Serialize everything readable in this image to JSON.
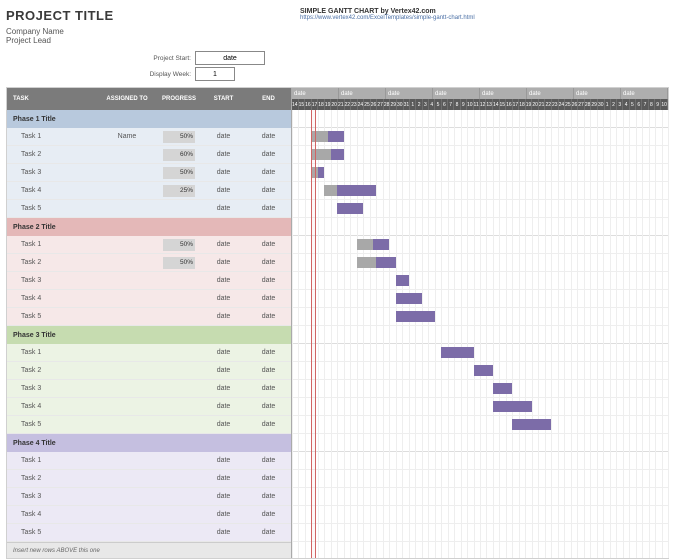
{
  "header": {
    "title": "PROJECT TITLE",
    "company": "Company Name",
    "lead": "Project Lead",
    "credit": "SIMPLE GANTT CHART by Vertex42.com",
    "url": "https://www.vertex42.com/ExcelTemplates/simple-gantt-chart.html",
    "project_start_label": "Project Start:",
    "project_start_value": "date",
    "display_week_label": "Display Week:",
    "display_week_value": "1"
  },
  "columns": {
    "task": "TASK",
    "assigned": "ASSIGNED TO",
    "progress": "PROGRESS",
    "start": "START",
    "end": "END"
  },
  "timeline": {
    "weeks": [
      "date",
      "date",
      "date",
      "date",
      "date",
      "date",
      "date",
      "date"
    ],
    "days": [
      "14",
      "15",
      "16",
      "17",
      "18",
      "19",
      "20",
      "21",
      "22",
      "23",
      "24",
      "25",
      "26",
      "27",
      "28",
      "29",
      "30",
      "31",
      "1",
      "2",
      "3",
      "4",
      "5",
      "6",
      "7",
      "8",
      "9",
      "10",
      "11",
      "12",
      "13",
      "14",
      "15",
      "16",
      "17",
      "18",
      "19",
      "20",
      "21",
      "22",
      "23",
      "24",
      "25",
      "26",
      "27",
      "28",
      "29",
      "30",
      "1",
      "2",
      "3",
      "4",
      "5",
      "6",
      "7",
      "8",
      "9",
      "10"
    ],
    "today_index": 3
  },
  "footer": "Insert new rows ABOVE this one",
  "phases": [
    {
      "title": "Phase 1 Title",
      "cls": "1",
      "tasks": [
        {
          "name": "Task 1",
          "assigned": "Name",
          "progress": "50%",
          "start": "date",
          "end": "date"
        },
        {
          "name": "Task 2",
          "assigned": "",
          "progress": "60%",
          "start": "date",
          "end": "date"
        },
        {
          "name": "Task 3",
          "assigned": "",
          "progress": "50%",
          "start": "date",
          "end": "date"
        },
        {
          "name": "Task 4",
          "assigned": "",
          "progress": "25%",
          "start": "date",
          "end": "date"
        },
        {
          "name": "Task 5",
          "assigned": "",
          "progress": "",
          "start": "date",
          "end": "date"
        }
      ]
    },
    {
      "title": "Phase 2 Title",
      "cls": "2",
      "tasks": [
        {
          "name": "Task 1",
          "assigned": "",
          "progress": "50%",
          "start": "date",
          "end": "date"
        },
        {
          "name": "Task 2",
          "assigned": "",
          "progress": "50%",
          "start": "date",
          "end": "date"
        },
        {
          "name": "Task 3",
          "assigned": "",
          "progress": "",
          "start": "date",
          "end": "date"
        },
        {
          "name": "Task 4",
          "assigned": "",
          "progress": "",
          "start": "date",
          "end": "date"
        },
        {
          "name": "Task 5",
          "assigned": "",
          "progress": "",
          "start": "date",
          "end": "date"
        }
      ]
    },
    {
      "title": "Phase 3 Title",
      "cls": "3",
      "tasks": [
        {
          "name": "Task 1",
          "assigned": "",
          "progress": "",
          "start": "date",
          "end": "date"
        },
        {
          "name": "Task 2",
          "assigned": "",
          "progress": "",
          "start": "date",
          "end": "date"
        },
        {
          "name": "Task 3",
          "assigned": "",
          "progress": "",
          "start": "date",
          "end": "date"
        },
        {
          "name": "Task 4",
          "assigned": "",
          "progress": "",
          "start": "date",
          "end": "date"
        },
        {
          "name": "Task 5",
          "assigned": "",
          "progress": "",
          "start": "date",
          "end": "date"
        }
      ]
    },
    {
      "title": "Phase 4 Title",
      "cls": "4",
      "tasks": [
        {
          "name": "Task 1",
          "assigned": "",
          "progress": "",
          "start": "date",
          "end": "date"
        },
        {
          "name": "Task 2",
          "assigned": "",
          "progress": "",
          "start": "date",
          "end": "date"
        },
        {
          "name": "Task 3",
          "assigned": "",
          "progress": "",
          "start": "date",
          "end": "date"
        },
        {
          "name": "Task 4",
          "assigned": "",
          "progress": "",
          "start": "date",
          "end": "date"
        },
        {
          "name": "Task 5",
          "assigned": "",
          "progress": "",
          "start": "date",
          "end": "date"
        }
      ]
    }
  ],
  "chart_data": {
    "type": "gantt",
    "title": "Simple Gantt Chart",
    "x_unit": "day_index",
    "x_range": [
      0,
      58
    ],
    "today_marker": 3,
    "bars": [
      {
        "phase": 1,
        "task": "Task 1",
        "start": 3,
        "duration": 5,
        "pct_complete": 50
      },
      {
        "phase": 1,
        "task": "Task 2",
        "start": 3,
        "duration": 5,
        "pct_complete": 60
      },
      {
        "phase": 1,
        "task": "Task 3",
        "start": 3,
        "duration": 2,
        "pct_complete": 50
      },
      {
        "phase": 1,
        "task": "Task 4",
        "start": 5,
        "duration": 8,
        "pct_complete": 25
      },
      {
        "phase": 1,
        "task": "Task 5",
        "start": 7,
        "duration": 4,
        "pct_complete": 0
      },
      {
        "phase": 2,
        "task": "Task 1",
        "start": 10,
        "duration": 5,
        "pct_complete": 50
      },
      {
        "phase": 2,
        "task": "Task 2",
        "start": 10,
        "duration": 6,
        "pct_complete": 50
      },
      {
        "phase": 2,
        "task": "Task 3",
        "start": 16,
        "duration": 2,
        "pct_complete": 0
      },
      {
        "phase": 2,
        "task": "Task 4",
        "start": 16,
        "duration": 4,
        "pct_complete": 0
      },
      {
        "phase": 2,
        "task": "Task 5",
        "start": 16,
        "duration": 6,
        "pct_complete": 0
      },
      {
        "phase": 3,
        "task": "Task 1",
        "start": 23,
        "duration": 5,
        "pct_complete": 0
      },
      {
        "phase": 3,
        "task": "Task 2",
        "start": 28,
        "duration": 3,
        "pct_complete": 0
      },
      {
        "phase": 3,
        "task": "Task 3",
        "start": 31,
        "duration": 3,
        "pct_complete": 0
      },
      {
        "phase": 3,
        "task": "Task 4",
        "start": 31,
        "duration": 6,
        "pct_complete": 0
      },
      {
        "phase": 3,
        "task": "Task 5",
        "start": 34,
        "duration": 6,
        "pct_complete": 0
      }
    ]
  }
}
